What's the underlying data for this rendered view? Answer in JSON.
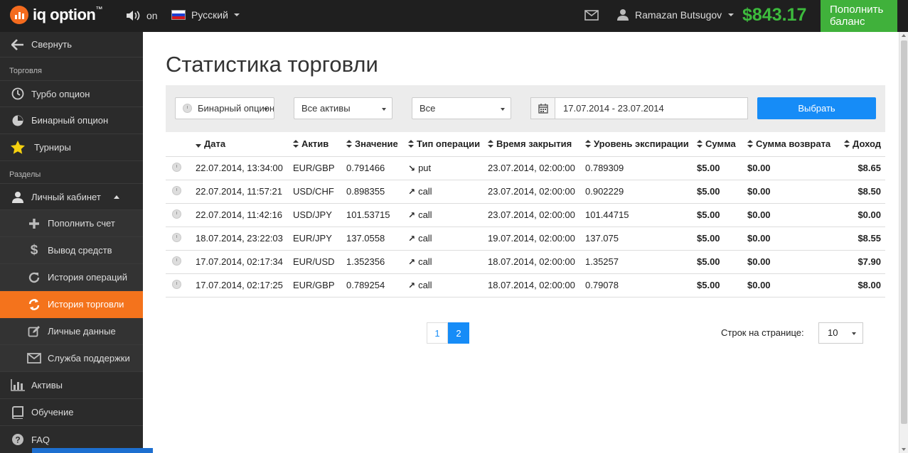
{
  "header": {
    "logo_text": "iq option",
    "logo_tm": "™",
    "sound_label": "on",
    "language": "Русский",
    "user_name": "Ramazan Butsugov",
    "balance": "$843.17",
    "topup_line1": "Пополнить",
    "topup_line2": "баланс"
  },
  "sidebar": {
    "collapse": "Свернуть",
    "section_trading": "Торговля",
    "turbo": "Турбо опцион",
    "binary": "Бинарный опцион",
    "tournaments": "Турниры",
    "section_sections": "Разделы",
    "cabinet": "Личный кабинет",
    "deposit": "Пополнить счет",
    "withdraw": "Вывод средств",
    "op_history": "История операций",
    "trade_history": "История торговли",
    "personal": "Личные данные",
    "support": "Служба поддержки",
    "assets": "Активы",
    "education": "Обучение",
    "faq": "FAQ"
  },
  "main": {
    "title": "Статистика торговли",
    "filters": {
      "option_type": "Бинарный опцион",
      "assets": "Все активы",
      "operation": "Все",
      "date_range": "17.07.2014 - 23.07.2014",
      "choose_button": "Выбрать"
    },
    "columns": [
      "Дата",
      "Актив",
      "Значение",
      "Тип операции",
      "Время закрытия",
      "Уровень экспирации",
      "Сумма",
      "Сумма возврата",
      "Доход"
    ],
    "rows": [
      {
        "date": "22.07.2014, 13:34:00",
        "asset": "EUR/GBP",
        "value": "0.791466",
        "type": "put",
        "close": "23.07.2014, 02:00:00",
        "expiry": "0.789309",
        "amount": "$5.00",
        "refund": "$0.00",
        "income": "$8.65"
      },
      {
        "date": "22.07.2014, 11:57:21",
        "asset": "USD/CHF",
        "value": "0.898355",
        "type": "call",
        "close": "23.07.2014, 02:00:00",
        "expiry": "0.902229",
        "amount": "$5.00",
        "refund": "$0.00",
        "income": "$8.50"
      },
      {
        "date": "22.07.2014, 11:42:16",
        "asset": "USD/JPY",
        "value": "101.53715",
        "type": "call",
        "close": "23.07.2014, 02:00:00",
        "expiry": "101.44715",
        "amount": "$5.00",
        "refund": "$0.00",
        "income": "$0.00"
      },
      {
        "date": "18.07.2014, 23:22:03",
        "asset": "EUR/JPY",
        "value": "137.0558",
        "type": "call",
        "close": "19.07.2014, 02:00:00",
        "expiry": "137.075",
        "amount": "$5.00",
        "refund": "$0.00",
        "income": "$8.55"
      },
      {
        "date": "17.07.2014, 02:17:34",
        "asset": "EUR/USD",
        "value": "1.352356",
        "type": "call",
        "close": "18.07.2014, 02:00:00",
        "expiry": "1.35257",
        "amount": "$5.00",
        "refund": "$0.00",
        "income": "$7.90"
      },
      {
        "date": "17.07.2014, 02:17:25",
        "asset": "EUR/GBP",
        "value": "0.789254",
        "type": "call",
        "close": "18.07.2014, 02:00:00",
        "expiry": "0.79078",
        "amount": "$5.00",
        "refund": "$0.00",
        "income": "$8.00"
      }
    ],
    "pagination": {
      "pages": [
        "1",
        "2"
      ],
      "current": "2"
    },
    "rows_per_page_label": "Строк на странице:",
    "rows_per_page": "10"
  },
  "colors": {
    "accent": "#f4731c",
    "primary": "#168cf7",
    "positive": "#3cab34",
    "negative": "#c0392b",
    "balance": "#3dbb3d"
  }
}
